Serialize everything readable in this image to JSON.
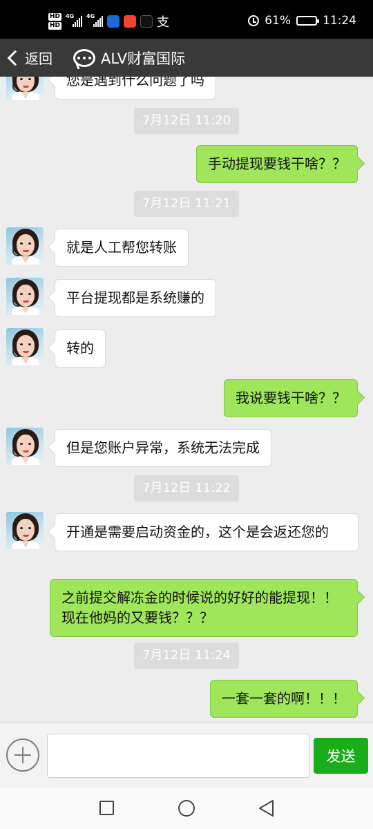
{
  "status_bar": {
    "battery": "61%",
    "battery_level": 0.61,
    "time": "11:24",
    "hd1": "HD",
    "hd2": "HD",
    "net1": "4G",
    "net2": "4G",
    "alipay": "支"
  },
  "header": {
    "back_label": "返回",
    "title": "ALV财富国际"
  },
  "messages": [
    {
      "type": "left",
      "text": "您是遇到什么问题了吗"
    },
    {
      "type": "time",
      "text": "7月12日 11:20"
    },
    {
      "type": "right",
      "text": "手动提现要钱干啥？？"
    },
    {
      "type": "time",
      "text": "7月12日 11:21"
    },
    {
      "type": "left",
      "text": "就是人工帮您转账"
    },
    {
      "type": "left",
      "text": "平台提现都是系统赚的"
    },
    {
      "type": "left",
      "text": "转的"
    },
    {
      "type": "right",
      "text": "我说要钱干啥？？"
    },
    {
      "type": "left",
      "text": "但是您账户异常，系统无法完成"
    },
    {
      "type": "time",
      "text": "7月12日 11:22"
    },
    {
      "type": "left",
      "text": "开通是需要启动资金的，这个是会返还您的"
    },
    {
      "type": "right",
      "text": "之前提交解冻金的时候说的好好的能提现！！现在他妈的又要钱？？？"
    },
    {
      "type": "time",
      "text": "7月12日 11:24"
    },
    {
      "type": "right",
      "text": "一套一套的啊！！！"
    }
  ],
  "input": {
    "value": "",
    "placeholder": "",
    "send_label": "发送"
  }
}
